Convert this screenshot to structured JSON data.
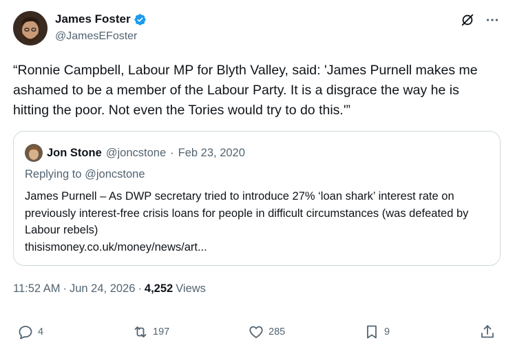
{
  "author": {
    "display_name": "James Foster",
    "handle": "@JamesEFoster"
  },
  "tweet": {
    "text": "“Ronnie Campbell, Labour MP for Blyth Valley, said: 'James Purnell makes me ashamed to be a member of the Labour Party. It is a disgrace the way he is hitting the poor. Not even the Tories would try to do this.'”"
  },
  "quote": {
    "display_name": "Jon Stone",
    "handle": "@joncstone",
    "separator": "·",
    "date": "Feb 23, 2020",
    "replying_to": "Replying to @joncstone",
    "text": "James Purnell – As DWP secretary tried to introduce 27% ‘loan shark’ interest rate on previously interest-free crisis loans for people in difficult circumstances (was defeated by Labour rebels)",
    "link": "thisismoney.co.uk/money/news/art..."
  },
  "meta": {
    "time": "11:52 AM",
    "sep1": "·",
    "date": "Jun 24, 2026",
    "sep2": "·",
    "views_count": "4,252",
    "views_label": "Views"
  },
  "actions": {
    "replies": "4",
    "reposts": "197",
    "likes": "285",
    "bookmarks": "9"
  },
  "colors": {
    "text": "#0f1419",
    "muted": "#536471",
    "border": "#cfd9de",
    "verified": "#1d9bf0"
  },
  "icons": [
    "verified-badge-icon",
    "grok-icon",
    "more-icon",
    "reply-icon",
    "repost-icon",
    "like-icon",
    "bookmark-icon",
    "share-icon"
  ]
}
